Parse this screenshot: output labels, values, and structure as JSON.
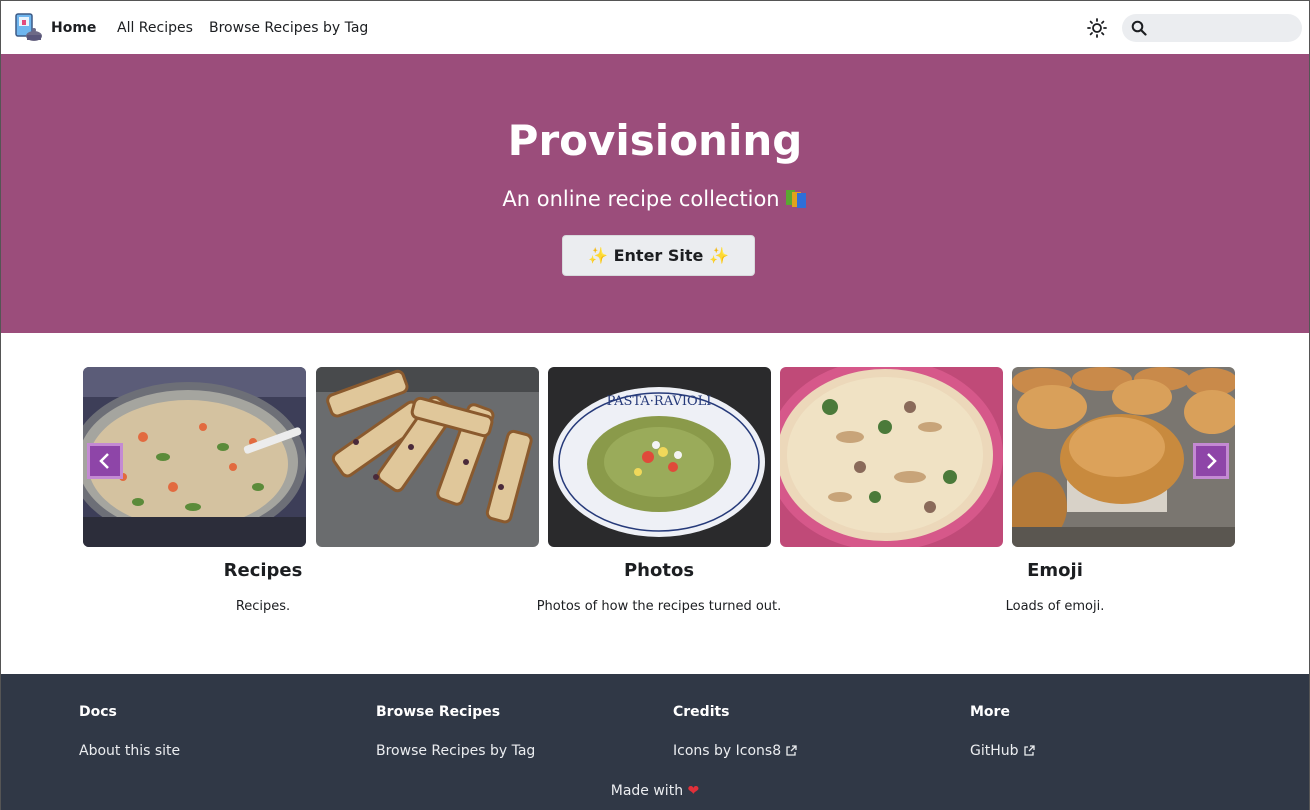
{
  "nav": {
    "brand": "Home",
    "links": [
      "All Recipes",
      "Browse Recipes by Tag"
    ],
    "search_placeholder": ""
  },
  "hero": {
    "title": "Provisioning",
    "subtitle": "An online recipe collection",
    "cta_label": "Enter Site",
    "background": "#9b4d7b"
  },
  "carousel": {
    "slides": [
      "soup-pot-photo",
      "biscotti-tray-photo",
      "pasta-plate-photo",
      "quiche-photo",
      "muffins-photo"
    ],
    "accent": "#8e45a8"
  },
  "features": [
    {
      "title": "Recipes",
      "text": "Recipes."
    },
    {
      "title": "Photos",
      "text": "Photos of how the recipes turned out."
    },
    {
      "title": "Emoji",
      "text": "Loads of emoji."
    }
  ],
  "footer": {
    "columns": [
      {
        "title": "Docs",
        "link": "About this site"
      },
      {
        "title": "Browse Recipes",
        "link": "Browse Recipes by Tag"
      },
      {
        "title": "Credits",
        "link": "Icons by Icons8"
      },
      {
        "title": "More",
        "link": "GitHub"
      }
    ],
    "made_with": "Made with",
    "background": "#303846"
  }
}
